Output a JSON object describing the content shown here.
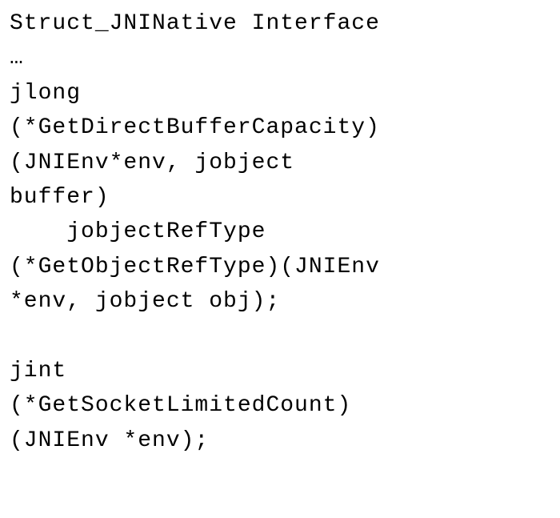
{
  "code": {
    "lines": [
      "Struct_JNINative Interface",
      "…",
      "jlong",
      "(*GetDirectBufferCapacity)",
      "(JNIEnv*env, jobject",
      "buffer)",
      "    jobjectRefType",
      "(*GetObjectRefType)(JNIEnv",
      "*env, jobject obj);",
      "",
      "jint",
      "(*GetSocketLimitedCount)",
      "(JNIEnv *env);"
    ]
  }
}
